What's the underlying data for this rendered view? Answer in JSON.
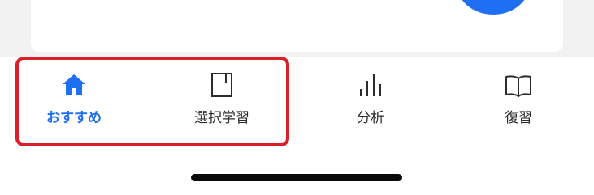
{
  "tabbar": {
    "tabs": [
      {
        "id": "recommend",
        "label": "おすすめ",
        "icon": "home-icon",
        "active": true
      },
      {
        "id": "select",
        "label": "選択学習",
        "icon": "notebook-icon",
        "active": false
      },
      {
        "id": "analysis",
        "label": "分析",
        "icon": "bar-chart-icon",
        "active": false
      },
      {
        "id": "review",
        "label": "復習",
        "icon": "open-book-icon",
        "active": false
      }
    ]
  },
  "colors": {
    "accent": "#1f6ff2",
    "annotation": "#d9202b",
    "text": "#2b2b2b",
    "background_top": "#f2f2f3"
  }
}
